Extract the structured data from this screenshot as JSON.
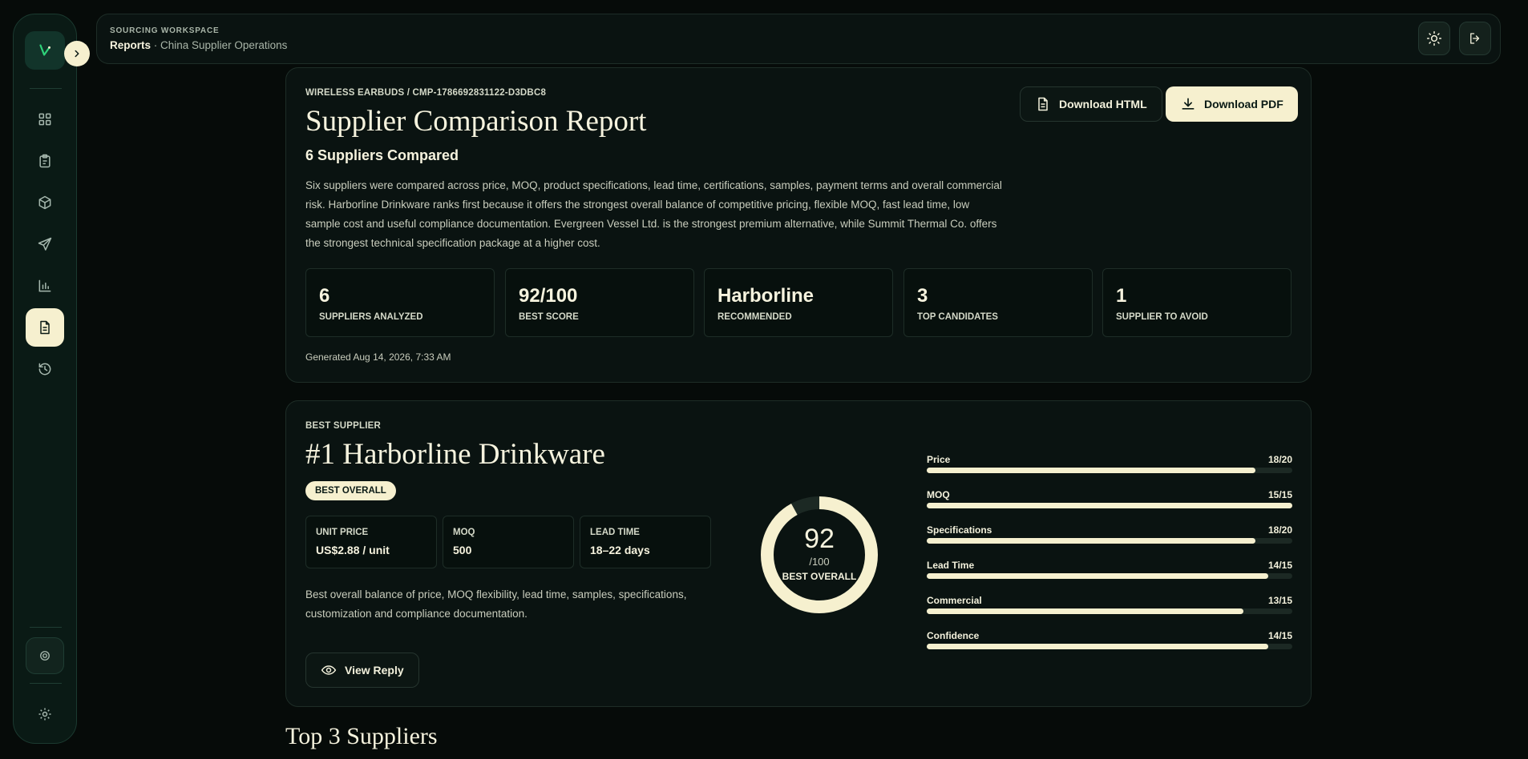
{
  "sidebar": {
    "items": [
      {
        "name": "dashboard",
        "active": false
      },
      {
        "name": "clipboard",
        "active": false
      },
      {
        "name": "package",
        "active": false
      },
      {
        "name": "send",
        "active": false
      },
      {
        "name": "analytics",
        "active": false
      },
      {
        "name": "reports",
        "active": true
      },
      {
        "name": "history",
        "active": false
      }
    ]
  },
  "header": {
    "workspace_label": "SOURCING WORKSPACE",
    "section": "Reports",
    "separator": " · ",
    "subsection": "China Supplier Operations"
  },
  "report": {
    "eyebrow": "WIRELESS EARBUDS / CMP-1786692831122-D3DBC8",
    "title": "Supplier Comparison Report",
    "subtitle": "6 Suppliers Compared",
    "summary": "Six suppliers were compared across price, MOQ, product specifications, lead time, certifications, samples, payment terms and overall commercial risk. Harborline Drinkware ranks first because it offers the strongest overall balance of competitive pricing, flexible MOQ, fast lead time, low sample cost and useful compliance documentation. Evergreen Vessel Ltd. is the strongest premium alternative, while Summit Thermal Co. offers the strongest technical specification package at a higher cost.",
    "download_html_label": "Download HTML",
    "download_pdf_label": "Download PDF",
    "stats": [
      {
        "value": "6",
        "label": "SUPPLIERS ANALYZED"
      },
      {
        "value": "92/100",
        "label": "BEST SCORE"
      },
      {
        "value": "Harborline",
        "label": "RECOMMENDED"
      },
      {
        "value": "3",
        "label": "TOP CANDIDATES"
      },
      {
        "value": "1",
        "label": "SUPPLIER TO AVOID"
      }
    ],
    "generated": "Generated Aug 14, 2026, 7:33 AM"
  },
  "best": {
    "eyebrow": "BEST SUPPLIER",
    "title": "#1 Harborline Drinkware",
    "badge": "BEST OVERALL",
    "metrics": [
      {
        "label": "UNIT PRICE",
        "value": "US$2.88 / unit"
      },
      {
        "label": "MOQ",
        "value": "500"
      },
      {
        "label": "LEAD TIME",
        "value": "18–22 days"
      }
    ],
    "description": "Best overall balance of price, MOQ flexibility, lead time, samples, specifications, customization and compliance documentation.",
    "view_reply_label": "View Reply",
    "score": 92,
    "score_max": "/100",
    "score_label": "BEST OVERALL",
    "breakdown": [
      {
        "name": "Price",
        "score": 18,
        "max": 20,
        "text": "18/20"
      },
      {
        "name": "MOQ",
        "score": 15,
        "max": 15,
        "text": "15/15"
      },
      {
        "name": "Specifications",
        "score": 18,
        "max": 20,
        "text": "18/20"
      },
      {
        "name": "Lead Time",
        "score": 14,
        "max": 15,
        "text": "14/15"
      },
      {
        "name": "Commercial",
        "score": 13,
        "max": 15,
        "text": "13/15"
      },
      {
        "name": "Confidence",
        "score": 14,
        "max": 15,
        "text": "14/15"
      }
    ]
  },
  "top3": {
    "title": "Top 3 Suppliers"
  },
  "colors": {
    "background": "#060b09",
    "accent": "#f6f0cf",
    "sidebar": "#0a1a15",
    "card": "#0a1311"
  }
}
